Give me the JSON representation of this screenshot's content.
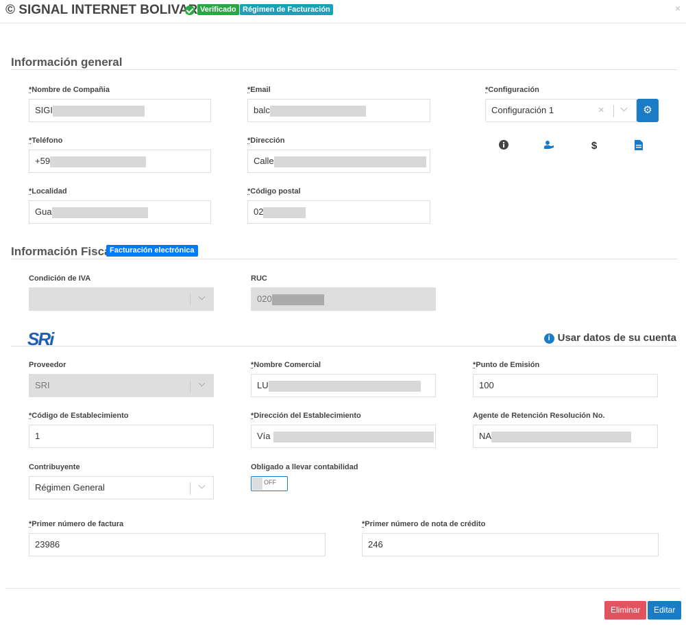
{
  "header": {
    "title": "© SIGNAL INTERNET BOLIVAR",
    "badge_verified": "Verificado",
    "badge_regimen": "Régimen de Facturación",
    "close": "×"
  },
  "general": {
    "title": "Información general",
    "company": {
      "label": "*Nombre de Compañia",
      "value": "SIGI"
    },
    "email": {
      "label": "*Email",
      "value": "balc"
    },
    "config": {
      "label": "*Configuración",
      "value": "Configuración 1",
      "clear": "×"
    },
    "phone": {
      "label": "*Teléfono",
      "value": "+59"
    },
    "address": {
      "label": "*Dirección",
      "value": "Calle"
    },
    "locality": {
      "label": "*Localidad",
      "value": "Gua"
    },
    "postal": {
      "label": "*Código postal",
      "value": "02"
    }
  },
  "fiscal": {
    "title": "Información Fiscal",
    "badge": "Facturación electrónica",
    "iva": {
      "label": "Condición de IVA",
      "value": ""
    },
    "ruc": {
      "label": "RUC",
      "value": "020"
    }
  },
  "sri": {
    "logo": "SRi",
    "use_account": "Usar datos de su cuenta",
    "provider": {
      "label": "Proveedor",
      "value": "SRI"
    },
    "commercial_name": {
      "label": "*Nombre Comercial",
      "value": "LU"
    },
    "emission_point": {
      "label": "*Punto de Emisión",
      "value": "100"
    },
    "establishment_code": {
      "label": "*Código de Establecimiento",
      "value": "1"
    },
    "establishment_address": {
      "label": "*Dirección del Establecimiento",
      "value": "Vía"
    },
    "retention_agent": {
      "label": "Agente de Retención Resolución No.",
      "value": "NA"
    },
    "taxpayer": {
      "label": "Contribuyente",
      "value": "Régimen General"
    },
    "accounting": {
      "label": "Obligado a llevar contabilidad",
      "value": "OFF"
    },
    "first_invoice": {
      "label": "*Primer número de factura",
      "value": "23986"
    },
    "first_credit_note": {
      "label": "*Primer número de nota de crédito",
      "value": "246"
    }
  },
  "footer": {
    "delete": "Eliminar",
    "edit": "Editar"
  },
  "icons": [
    "check-circle-icon",
    "close-icon",
    "gear-icon",
    "info-icon",
    "user-hand-icon",
    "dollar-icon",
    "document-icon"
  ]
}
